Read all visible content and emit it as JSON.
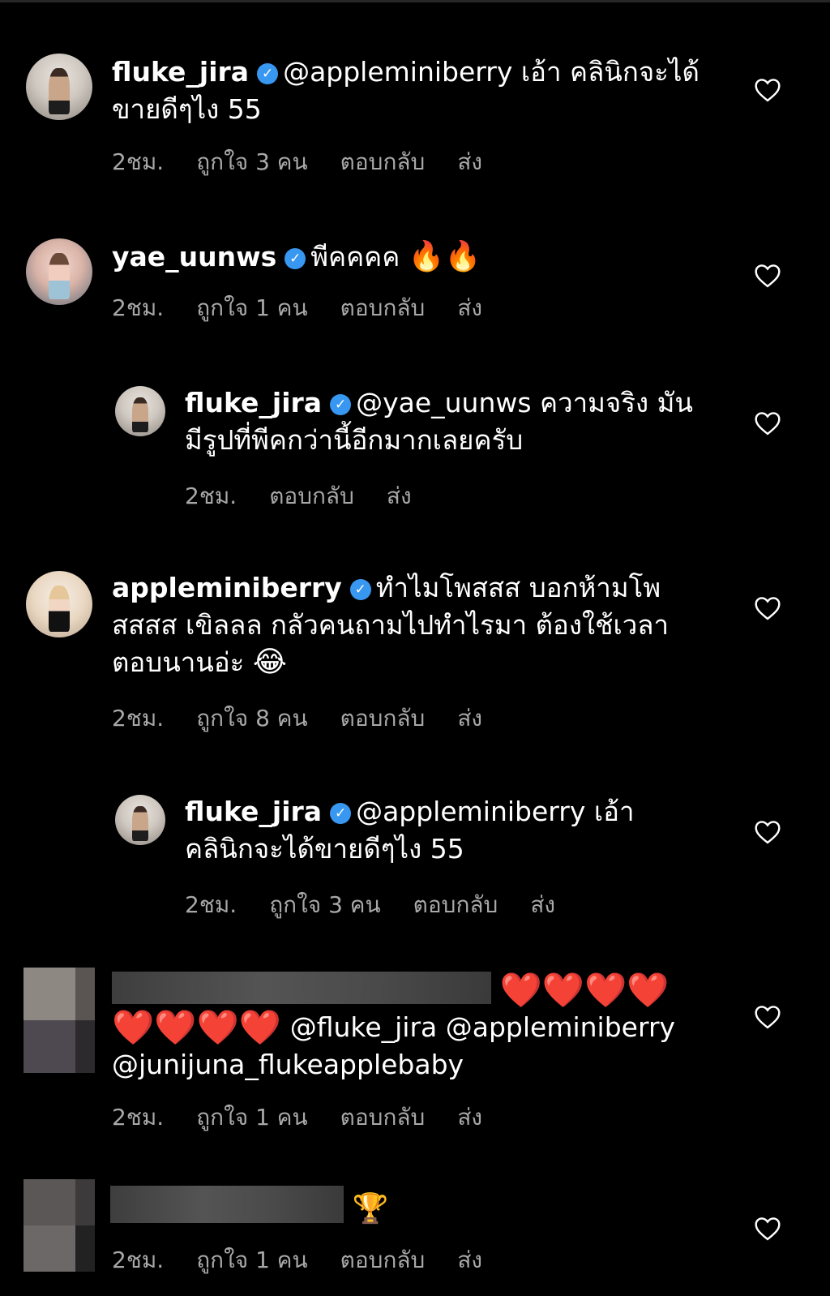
{
  "comments": [
    {
      "username": "fluke_jira",
      "line1": "@appleminiberry เอ้า คลินิกจะได้",
      "line2": "ขายดีๆไง 55",
      "time": "2ชม.",
      "likes": "ถูกใจ 3 คน",
      "reply": "ตอบกลับ",
      "send": "ส่ง"
    },
    {
      "username": "yae_uunws",
      "line1": "พีคคคค",
      "emoji": "🔥🔥",
      "time": "2ชม.",
      "likes": "ถูกใจ 1 คน",
      "reply": "ตอบกลับ",
      "send": "ส่ง"
    },
    {
      "username": "fluke_jira",
      "line1": "@yae_uunws ความจริง มัน",
      "line2": "มีรูปที่พีคกว่านี้อีกมากเลยครับ",
      "time": "2ชม.",
      "reply": "ตอบกลับ",
      "send": "ส่ง"
    },
    {
      "username": "appleminiberry",
      "line1": "ทำไมโพสสส บอกห้ามโพ",
      "line2": "สสสส เขิลลล กลัวคนถามไปทำไรมา ต้องใช้เวลา",
      "line3": "ตอบนานอ่ะ",
      "emoji": "😂",
      "time": "2ชม.",
      "likes": "ถูกใจ 8 คน",
      "reply": "ตอบกลับ",
      "send": "ส่ง"
    },
    {
      "username": "fluke_jira",
      "line1": "@appleminiberry เอ้า",
      "line2": "คลินิกจะได้ขายดีๆไง 55",
      "time": "2ชม.",
      "likes": "ถูกใจ 3 คน",
      "reply": "ตอบกลับ",
      "send": "ส่ง"
    },
    {
      "line1_hearts": "❤️❤️❤️❤️",
      "line2_hearts": "❤️❤️❤️❤️",
      "mentions": "@fluke_jira @appleminiberry",
      "line3": "@junijuna_flukeapplebaby",
      "time": "2ชม.",
      "likes": "ถูกใจ 1 คน",
      "reply": "ตอบกลับ",
      "send": "ส่ง"
    },
    {
      "emoji": "🏆",
      "time": "2ชม.",
      "likes": "ถูกใจ 1 คน",
      "reply": "ตอบกลับ",
      "send": "ส่ง"
    }
  ],
  "verified_glyph": "✓",
  "icons": {
    "like": "heart-outline-icon",
    "verified": "verified-badge-icon"
  },
  "colors": {
    "background": "#000000",
    "text": "#ffffff",
    "meta": "#a8a8a8",
    "verified": "#3897f0"
  }
}
